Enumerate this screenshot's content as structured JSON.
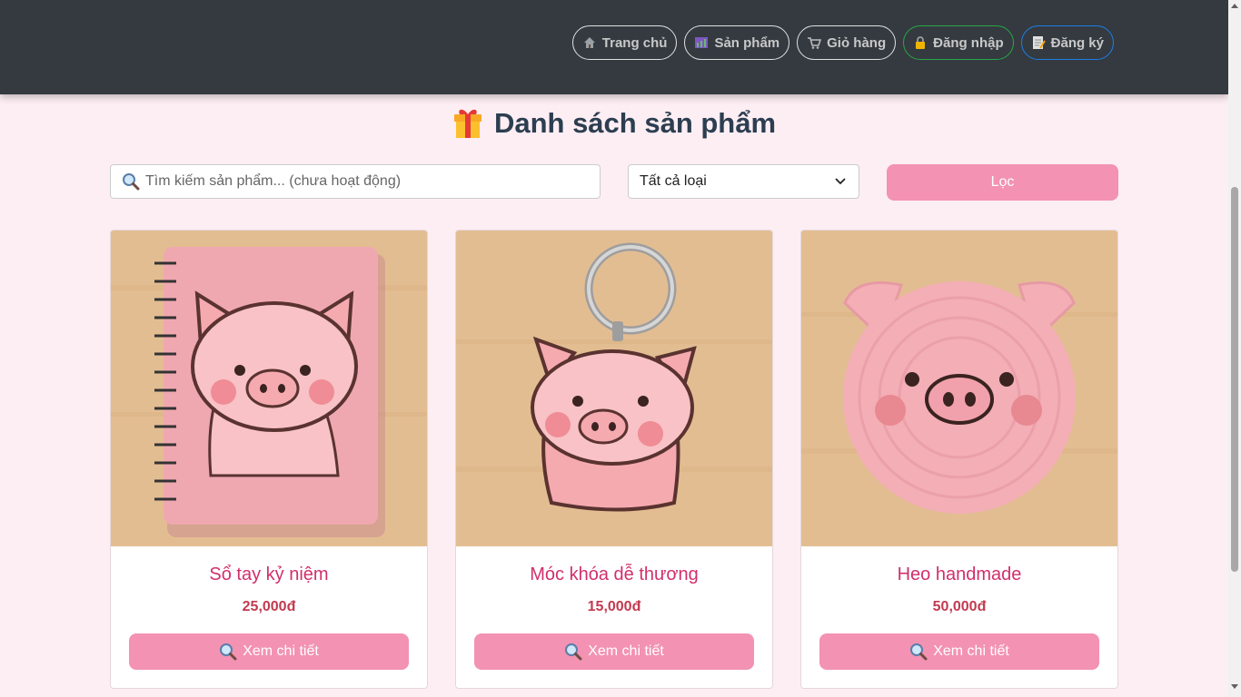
{
  "nav": {
    "items": [
      {
        "label": "Trang chủ",
        "icon": "home-icon"
      },
      {
        "label": "Sản phẩm",
        "icon": "products-icon"
      },
      {
        "label": "Giỏ hàng",
        "icon": "cart-icon"
      },
      {
        "label": "Đăng nhập",
        "icon": "lock-icon"
      },
      {
        "label": "Đăng ký",
        "icon": "memo-icon"
      }
    ]
  },
  "page": {
    "title": "Danh sách sản phẩm",
    "title_icon": "gift-icon"
  },
  "filters": {
    "search_placeholder": "Tìm kiếm sản phẩm... (chưa hoạt động)",
    "category_selected": "Tất cả loại",
    "filter_label": "Lọc"
  },
  "products": [
    {
      "name": "Sổ tay kỷ niệm",
      "price": "25,000đ",
      "button": "Xem chi tiết",
      "image": "pig-notebook"
    },
    {
      "name": "Móc khóa dễ thương",
      "price": "15,000đ",
      "button": "Xem chi tiết",
      "image": "pig-keychain"
    },
    {
      "name": "Heo handmade",
      "price": "50,000đ",
      "button": "Xem chi tiết",
      "image": "pig-crochet"
    }
  ],
  "colors": {
    "navbar": "#343a40",
    "background": "#fdeef4",
    "accent": "#f392b3",
    "product_name": "#d12f6b",
    "price": "#c23a4f"
  }
}
